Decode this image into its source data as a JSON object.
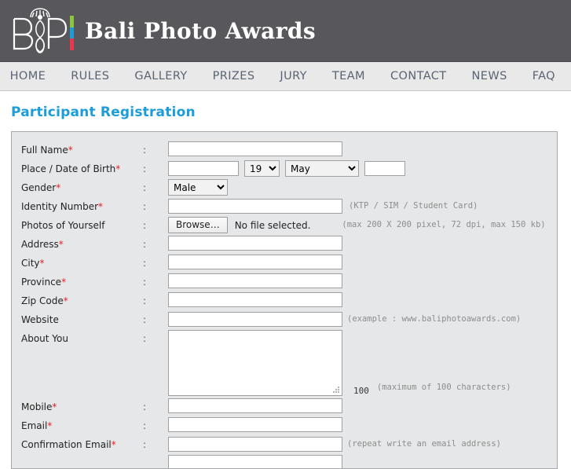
{
  "header": {
    "logo_mark": "bpa-monogram-logo",
    "brand_text": "Bali Photo Awards",
    "accent_colors": {
      "green": "#8cc63f",
      "blue": "#1b9dd9",
      "red": "#e8374a",
      "header_bg": "#58585c"
    }
  },
  "nav": {
    "items": [
      {
        "label": "HOME"
      },
      {
        "label": "RULES"
      },
      {
        "label": "GALLERY"
      },
      {
        "label": "PRIZES"
      },
      {
        "label": "JURY"
      },
      {
        "label": "TEAM"
      },
      {
        "label": "CONTACT"
      },
      {
        "label": "NEWS"
      },
      {
        "label": "FAQ"
      }
    ]
  },
  "page": {
    "title": "Participant Registration",
    "title_color": "#1b9dd9"
  },
  "form": {
    "colon": ":",
    "required_mark": "*",
    "rows": {
      "full_name": {
        "label": "Full Name",
        "value": ""
      },
      "birth": {
        "label": "Place / Date of Birth",
        "place_value": "",
        "day_value": "19",
        "month_value": "May",
        "year_value": ""
      },
      "gender": {
        "label": "Gender",
        "value": "Male"
      },
      "identity_number": {
        "label": "Identity Number",
        "value": "",
        "hint": "(KTP / SIM / Student Card)"
      },
      "photo": {
        "label": "Photos of Yourself",
        "browse_label": "Browse…",
        "file_status": "No file selected.",
        "hint": "(max 200 X 200 pixel, 72 dpi, max 150 kb)"
      },
      "address": {
        "label": "Address",
        "value": ""
      },
      "city": {
        "label": "City",
        "value": ""
      },
      "province": {
        "label": "Province",
        "value": ""
      },
      "zip_code": {
        "label": "Zip Code",
        "value": ""
      },
      "website": {
        "label": "Website",
        "value": "",
        "hint": "(example : www.baliphotoawards.com)"
      },
      "about_you": {
        "label": "About You",
        "value": "",
        "counter": "100",
        "hint": "(maximum of 100 characters)"
      },
      "mobile": {
        "label": "Mobile",
        "value": ""
      },
      "email": {
        "label": "Email",
        "value": ""
      },
      "confirmation_email": {
        "label": "Confirmation Email",
        "value": "",
        "hint": "(repeat write an email address)"
      }
    },
    "selects": {
      "day_options": [
        "19"
      ],
      "month_options": [
        "May"
      ],
      "gender_options": [
        "Male"
      ]
    }
  }
}
